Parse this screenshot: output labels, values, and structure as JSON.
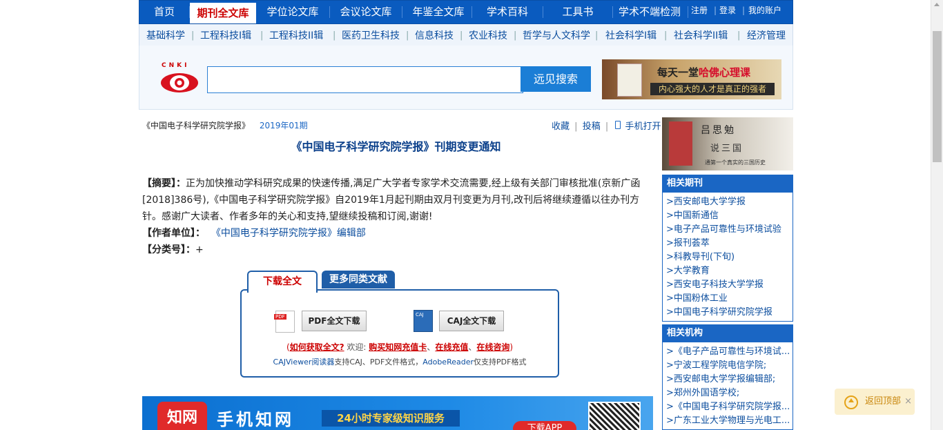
{
  "topnav": {
    "items": [
      "首页",
      "期刊全文库",
      "学位论文库",
      "会议论文库",
      "年鉴全文库",
      "学术百科",
      "工具书",
      "学术不端检测"
    ],
    "account": [
      "注册",
      "登录",
      "我的账户"
    ]
  },
  "subnav": [
    "基础科学",
    "工程科技I辑",
    "工程科技II辑",
    "医药卫生科技",
    "信息科技",
    "农业科技",
    "哲学与人文科学",
    "社会科学I辑",
    "社会科学II辑",
    "经济管理"
  ],
  "search": {
    "logo_text": "CNKI",
    "placeholder": "",
    "button": "远见搜索"
  },
  "ad_top": {
    "line1_prefix": "每天一堂",
    "line1_highlight": "哈佛心理课",
    "line2": "内心强大的人才是真正的强者"
  },
  "article": {
    "crumb_journal": "《中国电子科学研究院学报》",
    "crumb_issue": "2019年01期",
    "tools": [
      "收藏",
      "投稿",
      "手机打开"
    ],
    "title": "《中国电子科学研究院学报》刊期变更通知",
    "abstract_label": "【摘要】：",
    "abstract_text": "正为加快推动学科研究成果的快速传播,满足广大学者专家学术交流需要,经上级有关部门审核批准(京新广函[2018]386号),《中国电子科学研究院学报》自2019年1月起刊期由双月刊变更为月刊,改刊后将继续遵循以往办刊方针。感谢广大读者、作者多年的关心和支持,望继续投稿和订阅,谢谢!",
    "author_label": "【作者单位】：",
    "author_value": "《中国电子科学研究院学报》编辑部",
    "class_label": "【分类号】：",
    "class_value": "+"
  },
  "download": {
    "tab_active": "下载全文",
    "tab_other": "更多同类文献",
    "pdf_icon_text": "PDF",
    "caj_icon_text": "CAJ",
    "pdf_button": "PDF全文下载",
    "caj_button": "CAJ全文下载",
    "help_open": "(",
    "help_link": "如何获取全文?",
    "help_welcome": "欢迎:",
    "help_buy": "购买知网充值卡",
    "help_sep1": "、",
    "help_recharge": "在线充值",
    "help_sep2": "、",
    "help_consult": "在线咨询",
    "help_close": ")",
    "reader_app": "CAJViewer阅读器",
    "reader_text1": "支持CAJ、PDF文件格式，",
    "reader_adobe": "AdobeReader",
    "reader_text2": "仅支持PDF格式"
  },
  "banner": {
    "logo": "知网",
    "title": "手机知网",
    "slogan": "24小时专家级知识服务",
    "app_button": "下载APP"
  },
  "sidebar": {
    "ad": {
      "title": "吕思勉",
      "subtitle": "说三国",
      "tagline": "通第一个真实的三国历史"
    },
    "journals_title": "相关期刊",
    "journals": [
      ">西安邮电大学学报",
      ">中国新通信",
      ">电子产品可靠性与环境试验",
      ">报刊荟萃",
      ">科教导刊(下旬)",
      ">大学教育",
      ">西安电子科技大学学报",
      ">中国粉体工业",
      ">中国电子科学研究院学报"
    ],
    "orgs_title": "相关机构",
    "orgs": [
      ">《电子产品可靠性与环境试...",
      ">宁波工程学院电信学院;",
      ">西安邮电大学学报编辑部;",
      ">郑州外国语学校;",
      ">《中国电子科学研究院学报...",
      ">广东工业大学物理与光电工..."
    ]
  },
  "backtop": {
    "label": "返回顶部",
    "close": "×"
  },
  "colors": {
    "nav": "#0a5bbf",
    "accent_red": "#cc0000",
    "link": "#0b4d9e"
  }
}
